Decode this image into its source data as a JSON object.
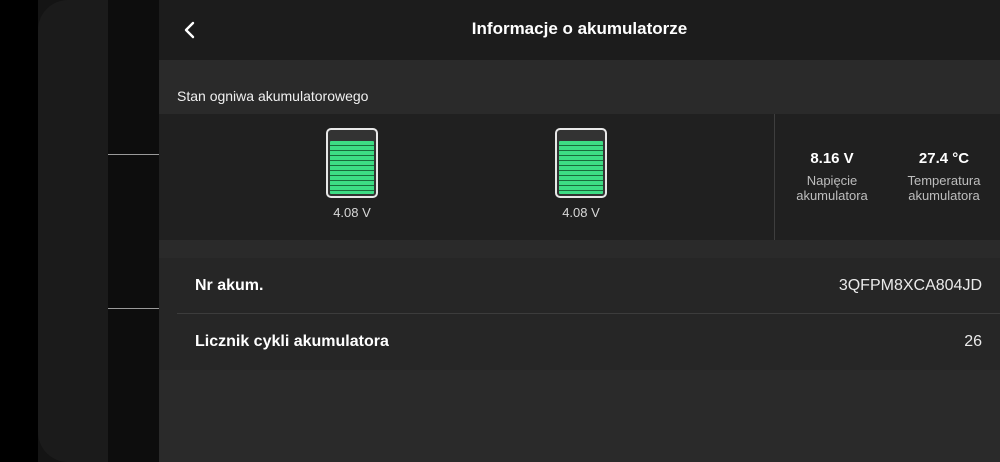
{
  "header": {
    "title": "Informacje o akumulatorze",
    "back_icon": "chevron-left-icon"
  },
  "cells_section": {
    "label": "Stan ogniwa akumulatorowego",
    "cells": [
      {
        "voltage": "4.08 V",
        "charge_fraction": 0.85
      },
      {
        "voltage": "4.08 V",
        "charge_fraction": 0.85
      }
    ],
    "battery_voltage": {
      "value": "8.16 V",
      "label": "Napięcie akumulatora"
    },
    "temperature": {
      "value": "27.4 °C",
      "label": "Temperatura akumulatora"
    }
  },
  "info": {
    "serial": {
      "label": "Nr akum.",
      "value": "3QFPM8XCA804JD"
    },
    "cycles": {
      "label": "Licznik cykli akumulatora",
      "value": "26"
    }
  },
  "colors": {
    "charge": "#3ddc84",
    "panel": "#2a2a2a",
    "header": "#1c1c1c"
  }
}
